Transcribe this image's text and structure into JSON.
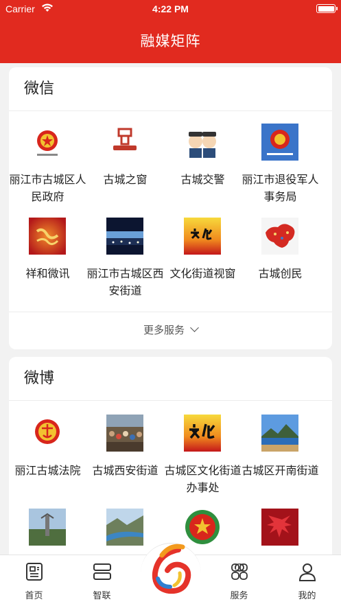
{
  "status_bar": {
    "carrier": "Carrier",
    "time": "4:22 PM"
  },
  "nav": {
    "title": "融媒矩阵"
  },
  "wechat": {
    "title": "微信",
    "items": [
      {
        "label": "丽江市古城区人民政府",
        "icon": "national-emblem-icon"
      },
      {
        "label": "古城之窗",
        "icon": "gucheng-window-logo-icon"
      },
      {
        "label": "古城交警",
        "icon": "traffic-police-cartoon-icon"
      },
      {
        "label": "丽江市退役军人事务局",
        "icon": "veterans-affairs-emblem-icon"
      },
      {
        "label": "祥和微讯",
        "icon": "xianghe-logo-icon"
      },
      {
        "label": "丽江市古城区西安街道",
        "icon": "city-night-photo-icon"
      },
      {
        "label": "文化街道视窗",
        "icon": "wenhua-calligraphy-icon"
      },
      {
        "label": "古城创民",
        "icon": "china-map-icon"
      }
    ],
    "more_label": "更多服务"
  },
  "weibo": {
    "title": "微博",
    "items": [
      {
        "label": "丽江古城法院",
        "icon": "court-emblem-icon"
      },
      {
        "label": "古城西安街道",
        "icon": "crowd-photo-icon"
      },
      {
        "label": "古城区文化街道办事处",
        "icon": "wenhua-calligraphy-icon"
      },
      {
        "label": "古城区开南街道",
        "icon": "lake-mountain-photo-icon"
      },
      {
        "label": "",
        "icon": "monument-photo-icon"
      },
      {
        "label": "",
        "icon": "river-valley-photo-icon"
      },
      {
        "label": "",
        "icon": "emblem-seal-icon"
      },
      {
        "label": "",
        "icon": "red-leaves-photo-icon"
      }
    ]
  },
  "tabs": [
    {
      "label": "首页",
      "icon": "news-icon"
    },
    {
      "label": "智联",
      "icon": "cards-stack-icon"
    },
    {
      "label": "",
      "icon": "center-logo-icon"
    },
    {
      "label": "服务",
      "icon": "grid-flower-icon"
    },
    {
      "label": "我的",
      "icon": "person-icon"
    }
  ],
  "colors": {
    "brand_red": "#e12a1f",
    "background": "#f2f2f2"
  }
}
